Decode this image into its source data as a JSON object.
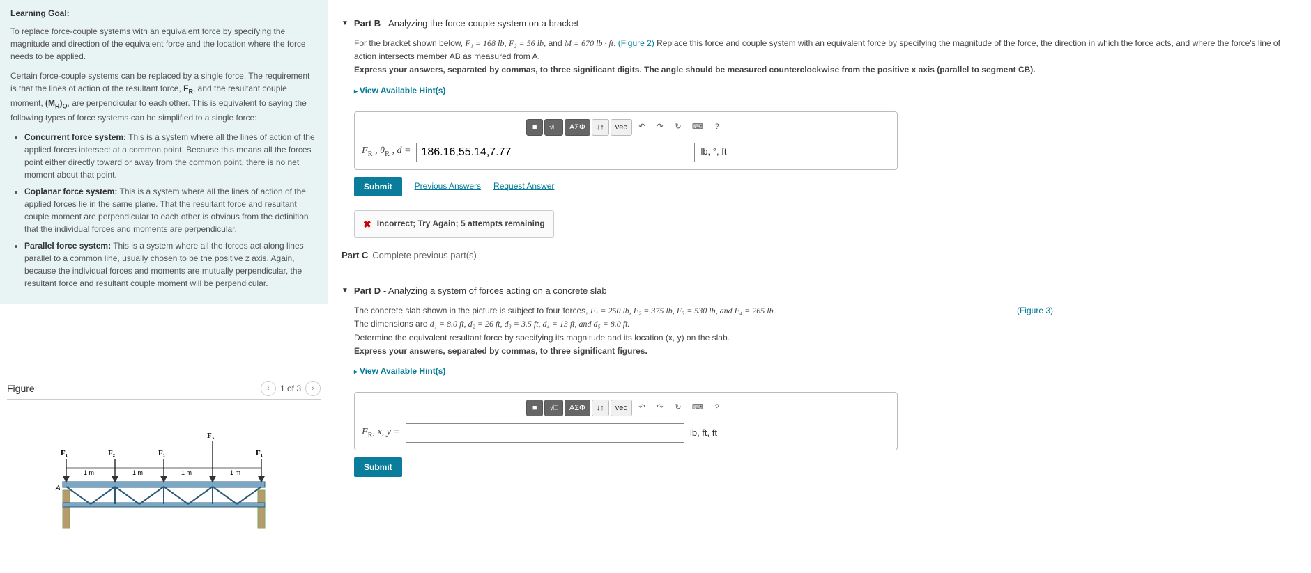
{
  "learning_goal": {
    "heading": "Learning Goal:",
    "intro": "To replace force-couple systems with an equivalent force by specifying the magnitude and direction of the equivalent force and the location where the force needs to be applied.",
    "para2_pre": "Certain force-couple systems can be replaced by a single force. The requirement is that the lines of action of the resultant force, ",
    "para2_fr": "F_R",
    "para2_mid": ", and the resultant couple moment, ",
    "para2_mro": "(M_R)_O",
    "para2_post": ", are perpendicular to each other. This is equivalent to saying the following types of force systems can be simplified to a single force:",
    "bullets": [
      {
        "title": "Concurrent force system:",
        "body": " This is a system where all the lines of action of the applied forces intersect at a common point. Because this means all the forces point either directly toward or away from the common point, there is no net moment about that point."
      },
      {
        "title": "Coplanar force system:",
        "body": " This is a system where all the lines of action of the applied forces lie in the same plane. That the resultant force and resultant couple moment are perpendicular to each other is obvious from the definition that the individual forces and moments are perpendicular."
      },
      {
        "title": "Parallel force system:",
        "body": " This is a system where all the forces act along lines parallel to a common line, usually chosen to be the positive z axis. Again, because the individual forces and moments are mutually perpendicular, the resultant force and resultant couple moment will be perpendicular."
      }
    ]
  },
  "figure": {
    "title": "Figure",
    "counter": "1 of 3",
    "labels": {
      "F1": "F₁",
      "F2": "F₂",
      "F3": "F₃",
      "A": "A",
      "m": "1 m"
    }
  },
  "partB": {
    "title": "Part B",
    "subtitle": " - Analyzing the force-couple system on a bracket",
    "desc_pre": "For the bracket shown below, ",
    "f1": "F₁ = 168 lb",
    "f2": "F₂ = 56 lb",
    "m": "M = 670 lb · ft",
    "fig_link": "(Figure 2)",
    "desc_post": "Replace this force and couple system with an equivalent force by specifying the magnitude of the force, the direction in which the force acts, and where the force's line of action intersects member AB as measured from A.",
    "express": "Express your answers, separated by commas, to three significant digits. The angle should be measured counterclockwise from the positive x axis (parallel to segment CB).",
    "hints": "View Available Hint(s)",
    "answer_label": "F_R , θ_R , d =",
    "answer_value": "186.16,55.14,7.77",
    "units": "lb, °, ft",
    "submit": "Submit",
    "prev": "Previous Answers",
    "req": "Request Answer",
    "feedback": "Incorrect; Try Again; 5 attempts remaining"
  },
  "partC": {
    "title": "Part C",
    "subtitle": "Complete previous part(s)"
  },
  "partD": {
    "title": "Part D",
    "subtitle": " - Analyzing a system of forces acting on a concrete slab",
    "line1_pre": "The concrete slab shown in the picture is subject to four forces, ",
    "line1_vals": "F₁ = 250 lb, F₂ = 375 lb, F₃ = 530 lb, and F₄ = 265 lb.",
    "fig_link": "(Figure 3)",
    "line2_pre": "The dimensions are ",
    "line2_vals": "d₁ = 8.0 ft, d₂ = 26 ft, d₃ = 3.5 ft, d₄ = 13 ft, and d₅ = 8.0 ft.",
    "line3": "Determine the equivalent resultant force by specifying its magnitude and its location (x, y) on the slab.",
    "express": "Express your answers, separated by commas, to three significant figures.",
    "hints": "View Available Hint(s)",
    "answer_label": "F_R, x, y =",
    "answer_value": "",
    "units": "lb, ft, ft",
    "submit": "Submit"
  },
  "toolbar": {
    "templates": "■",
    "sqrt": "√□",
    "greek": "ΑΣΦ",
    "subsup": "↓↑",
    "vec": "vec",
    "undo": "↶",
    "redo": "↷",
    "reset": "↻",
    "keyboard": "⌨",
    "help": "?"
  }
}
